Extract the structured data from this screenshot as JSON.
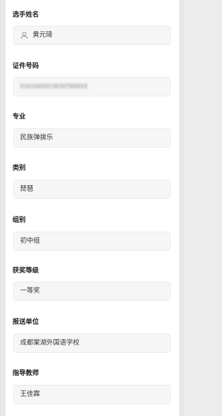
{
  "fields": [
    {
      "label": "选手姓名",
      "value": "黄元琦",
      "icon": "user-icon"
    },
    {
      "label": "证件号码",
      "value": "5101042013030700XXX"
    },
    {
      "label": "专业",
      "value": "民族弹拨乐"
    },
    {
      "label": "类别",
      "value": "琵琶"
    },
    {
      "label": "组别",
      "value": "初中组"
    },
    {
      "label": "获奖等级",
      "value": "一等奖"
    },
    {
      "label": "报送单位",
      "value": "成都棠湖外国语学校"
    },
    {
      "label": "指导教师",
      "value": "王佳霖"
    }
  ]
}
